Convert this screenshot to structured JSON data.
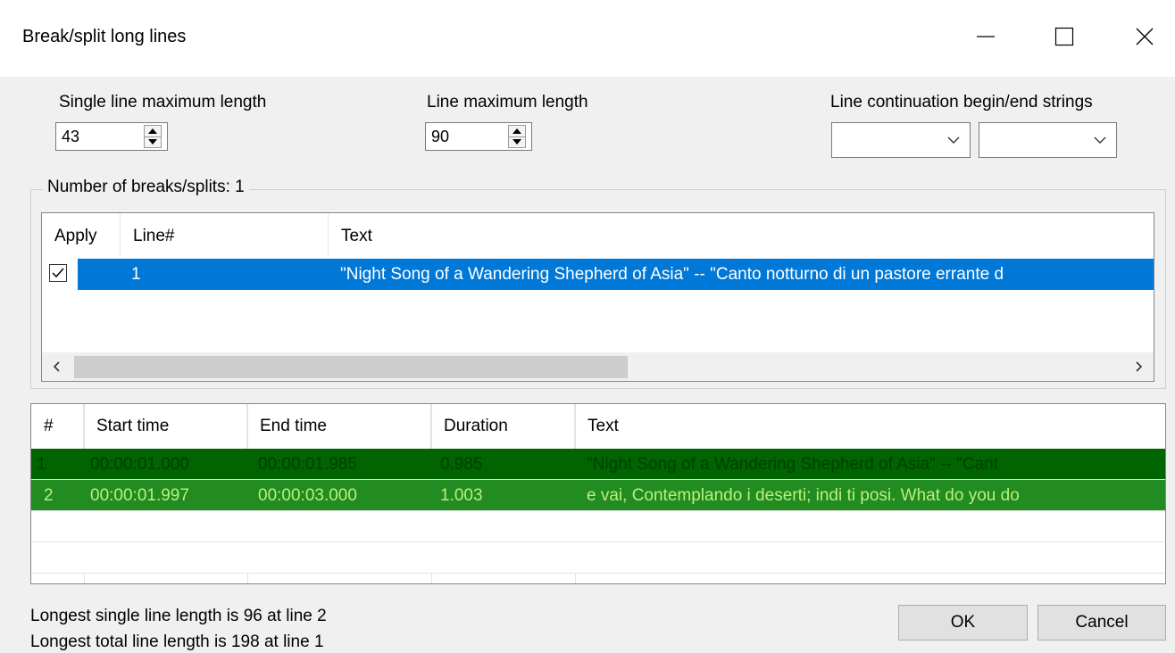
{
  "window": {
    "title": "Break/split long lines",
    "minimize_icon": "minimize-icon",
    "maximize_icon": "maximize-icon",
    "close_icon": "close-icon"
  },
  "settings": {
    "single_line_max": {
      "label": "Single line maximum length",
      "value": "43"
    },
    "line_max": {
      "label": "Line maximum length",
      "value": "90"
    },
    "continuation": {
      "label": "Line continuation begin/end strings",
      "begin_value": "",
      "end_value": ""
    }
  },
  "breaks": {
    "group_label": "Number of breaks/splits: 1",
    "columns": [
      "Apply",
      "Line#",
      "Text"
    ],
    "rows": [
      {
        "apply": true,
        "line": "1",
        "text": "\"Night Song of a Wandering Shepherd of Asia\" -- \"Canto notturno di un pastore errante d"
      }
    ]
  },
  "subtitles": {
    "columns": [
      "#",
      "Start time",
      "End time",
      "Duration",
      "Text"
    ],
    "rows": [
      {
        "num": "1",
        "start": "00:00:01.000",
        "end": "00:00:01.985",
        "duration": "0.985",
        "text": "\"Night Song of a Wandering Shepherd of Asia\" -- \"Cant"
      },
      {
        "num": "2",
        "start": "00:00:01.997",
        "end": "00:00:03.000",
        "duration": "1.003",
        "text": "e vai, Contemplando i deserti; indi ti posi.  What do you do"
      }
    ]
  },
  "status": {
    "line1": "Longest single line length is 96 at line 2",
    "line2": "Longest total line length is 198 at line 1"
  },
  "buttons": {
    "ok": "OK",
    "cancel": "Cancel"
  },
  "colors": {
    "selection": "#0078d7",
    "row1_bg": "#006400",
    "row2_bg": "#228b22"
  }
}
